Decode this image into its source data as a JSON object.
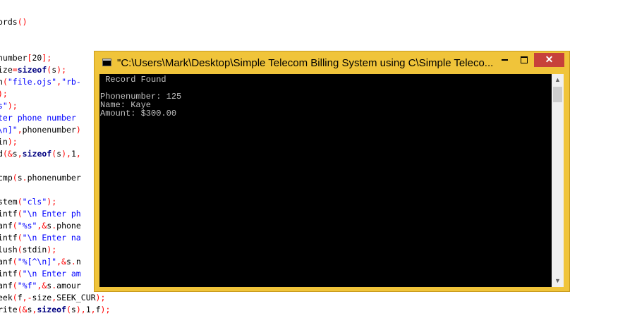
{
  "editor": {
    "lines": [
      [
        {
          "t": "ords",
          "c": "plain"
        },
        {
          "t": "()",
          "c": "punc"
        }
      ],
      [],
      [],
      [
        {
          "t": "number",
          "c": "plain"
        },
        {
          "t": "[",
          "c": "punc"
        },
        {
          "t": "20",
          "c": "plain"
        },
        {
          "t": "];",
          "c": "punc"
        }
      ],
      [
        {
          "t": "ize",
          "c": "plain"
        },
        {
          "t": "=",
          "c": "punc"
        },
        {
          "t": "sizeof",
          "c": "kw"
        },
        {
          "t": "(",
          "c": "punc"
        },
        {
          "t": "s",
          "c": "plain"
        },
        {
          "t": ");",
          "c": "punc"
        }
      ],
      [
        {
          "t": "n",
          "c": "plain"
        },
        {
          "t": "(",
          "c": "punc"
        },
        {
          "t": "\"file.ojs\"",
          "c": "str"
        },
        {
          "t": ",",
          "c": "punc"
        },
        {
          "t": "\"rb-",
          "c": "str"
        }
      ],
      [
        {
          "t": ");",
          "c": "punc"
        }
      ],
      [
        {
          "t": "s\"",
          "c": "str"
        },
        {
          "t": ");",
          "c": "punc"
        }
      ],
      [
        {
          "t": "ter phone number",
          "c": "str"
        }
      ],
      [
        {
          "t": "\\n]\"",
          "c": "str"
        },
        {
          "t": ",",
          "c": "punc"
        },
        {
          "t": "phonenumber",
          "c": "plain"
        },
        {
          "t": ")",
          "c": "punc"
        }
      ],
      [
        {
          "t": "in",
          "c": "plain"
        },
        {
          "t": ");",
          "c": "punc"
        }
      ],
      [
        {
          "t": "d",
          "c": "plain"
        },
        {
          "t": "(&",
          "c": "punc"
        },
        {
          "t": "s",
          "c": "plain"
        },
        {
          "t": ",",
          "c": "punc"
        },
        {
          "t": "sizeof",
          "c": "kw"
        },
        {
          "t": "(",
          "c": "punc"
        },
        {
          "t": "s",
          "c": "plain"
        },
        {
          "t": "),",
          "c": "punc"
        },
        {
          "t": "1",
          "c": "plain"
        },
        {
          "t": ",",
          "c": "punc"
        }
      ],
      [],
      [
        {
          "t": "cmp",
          "c": "plain"
        },
        {
          "t": "(",
          "c": "punc"
        },
        {
          "t": "s",
          "c": "plain"
        },
        {
          "t": ".",
          "c": "punc"
        },
        {
          "t": "phonenumber",
          "c": "plain"
        }
      ],
      [],
      [
        {
          "t": "stem",
          "c": "plain"
        },
        {
          "t": "(",
          "c": "punc"
        },
        {
          "t": "\"cls\"",
          "c": "str"
        },
        {
          "t": ");",
          "c": "punc"
        }
      ],
      [
        {
          "t": "intf",
          "c": "plain"
        },
        {
          "t": "(",
          "c": "punc"
        },
        {
          "t": "\"\\n Enter ph",
          "c": "str"
        }
      ],
      [
        {
          "t": "anf",
          "c": "plain"
        },
        {
          "t": "(",
          "c": "punc"
        },
        {
          "t": "\"%s\"",
          "c": "str"
        },
        {
          "t": ",&",
          "c": "punc"
        },
        {
          "t": "s",
          "c": "plain"
        },
        {
          "t": ".",
          "c": "punc"
        },
        {
          "t": "phone",
          "c": "plain"
        }
      ],
      [
        {
          "t": "intf",
          "c": "plain"
        },
        {
          "t": "(",
          "c": "punc"
        },
        {
          "t": "\"\\n Enter na",
          "c": "str"
        }
      ],
      [
        {
          "t": "lush",
          "c": "plain"
        },
        {
          "t": "(",
          "c": "punc"
        },
        {
          "t": "stdin",
          "c": "plain"
        },
        {
          "t": ");",
          "c": "punc"
        }
      ],
      [
        {
          "t": "anf",
          "c": "plain"
        },
        {
          "t": "(",
          "c": "punc"
        },
        {
          "t": "\"%[^\\n]\"",
          "c": "str"
        },
        {
          "t": ",&",
          "c": "punc"
        },
        {
          "t": "s",
          "c": "plain"
        },
        {
          "t": ".",
          "c": "punc"
        },
        {
          "t": "n",
          "c": "plain"
        }
      ],
      [
        {
          "t": "intf",
          "c": "plain"
        },
        {
          "t": "(",
          "c": "punc"
        },
        {
          "t": "\"\\n Enter am",
          "c": "str"
        }
      ],
      [
        {
          "t": "anf",
          "c": "plain"
        },
        {
          "t": "(",
          "c": "punc"
        },
        {
          "t": "\"%f\"",
          "c": "str"
        },
        {
          "t": ",&",
          "c": "punc"
        },
        {
          "t": "s",
          "c": "plain"
        },
        {
          "t": ".",
          "c": "punc"
        },
        {
          "t": "amour",
          "c": "plain"
        }
      ],
      [
        {
          "t": "eek",
          "c": "plain"
        },
        {
          "t": "(",
          "c": "punc"
        },
        {
          "t": "f",
          "c": "plain"
        },
        {
          "t": ",-",
          "c": "punc"
        },
        {
          "t": "size",
          "c": "plain"
        },
        {
          "t": ",",
          "c": "punc"
        },
        {
          "t": "SEEK_CUR",
          "c": "plain"
        },
        {
          "t": ");",
          "c": "punc"
        }
      ],
      [
        {
          "t": "rite",
          "c": "plain"
        },
        {
          "t": "(&",
          "c": "punc"
        },
        {
          "t": "s",
          "c": "plain"
        },
        {
          "t": ",",
          "c": "punc"
        },
        {
          "t": "sizeof",
          "c": "kw"
        },
        {
          "t": "(",
          "c": "punc"
        },
        {
          "t": "s",
          "c": "plain"
        },
        {
          "t": "),",
          "c": "punc"
        },
        {
          "t": "1",
          "c": "plain"
        },
        {
          "t": ",",
          "c": "punc"
        },
        {
          "t": "f",
          "c": "plain"
        },
        {
          "t": ");",
          "c": "punc"
        }
      ]
    ]
  },
  "window": {
    "title": "\"C:\\Users\\Mark\\Desktop\\Simple Telecom Billing System using C\\Simple Teleco...",
    "close_glyph": "✕",
    "scroll_up_glyph": "▲",
    "scroll_down_glyph": "▼",
    "colors": {
      "frame": "#f0c43a",
      "close": "#c7413a",
      "console_bg": "#000000",
      "console_fg": "#c0c0c0"
    }
  },
  "console": {
    "lines": [
      " Record Found",
      "",
      "Phonenumber: 125",
      "Name: Kaye",
      "Amount: $300.00"
    ]
  }
}
